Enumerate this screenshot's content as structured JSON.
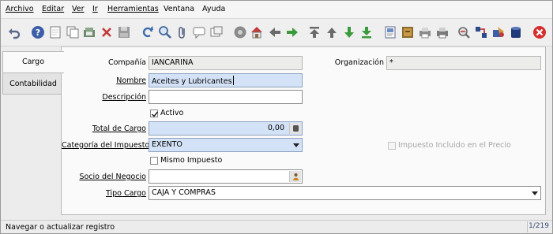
{
  "menu": {
    "archivo": "Archivo",
    "editar": "Editar",
    "ver": "Ver",
    "ir": "Ir",
    "herramientas": "Herramientas",
    "ventana": "Ventana",
    "ayuda": "Ayuda"
  },
  "toolbar": {
    "icons": [
      "undo-icon",
      "help-icon",
      "new-record-icon",
      "copy-record-icon",
      "delete-icon",
      "delete-selection-icon",
      "save-icon",
      "refresh-icon",
      "find-icon",
      "attachment-icon",
      "chat-icon",
      "history-icon",
      "menu-icon",
      "home-icon",
      "back-icon",
      "forward-icon",
      "first-record-icon",
      "previous-record-icon",
      "next-record-icon",
      "last-record-icon",
      "report-icon",
      "archive-icon",
      "print-preview-icon",
      "print-icon",
      "zoom-across-icon",
      "active-workflows-icon",
      "requests-icon",
      "product-info-icon",
      "exit-icon"
    ]
  },
  "tabs": [
    "Cargo",
    "Contabilidad"
  ],
  "form": {
    "company_label": "Compañía",
    "company_value": "IANCARINA",
    "organization_label": "Organización",
    "organization_value": "*",
    "name_label": "Nombre",
    "name_value": "Aceites y Lubricantes",
    "description_label": "Descripción",
    "description_value": "",
    "active_label": "Activo",
    "active_checked": true,
    "total_charge_label": "Total de Cargo",
    "total_charge_value": "0,00",
    "tax_category_label": "Categoría del Impuesto",
    "tax_category_value": "EXENTO",
    "tax_included_label": "Impuesto Incluido en el Precio",
    "tax_included_checked": false,
    "same_tax_label": "Mismo Impuesto",
    "same_tax_checked": false,
    "business_partner_label": "Socio del Negocio",
    "business_partner_value": "",
    "charge_type_label": "Tipo Cargo",
    "charge_type_value": "CAJA Y COMPRAS"
  },
  "status": {
    "message": "Navegar o actualizar registro",
    "record_count": "1/219"
  },
  "colors": {
    "mandatory_field": "#d3e2f6",
    "readonly_field": "#ececea",
    "accent": "#3a6ab0"
  }
}
